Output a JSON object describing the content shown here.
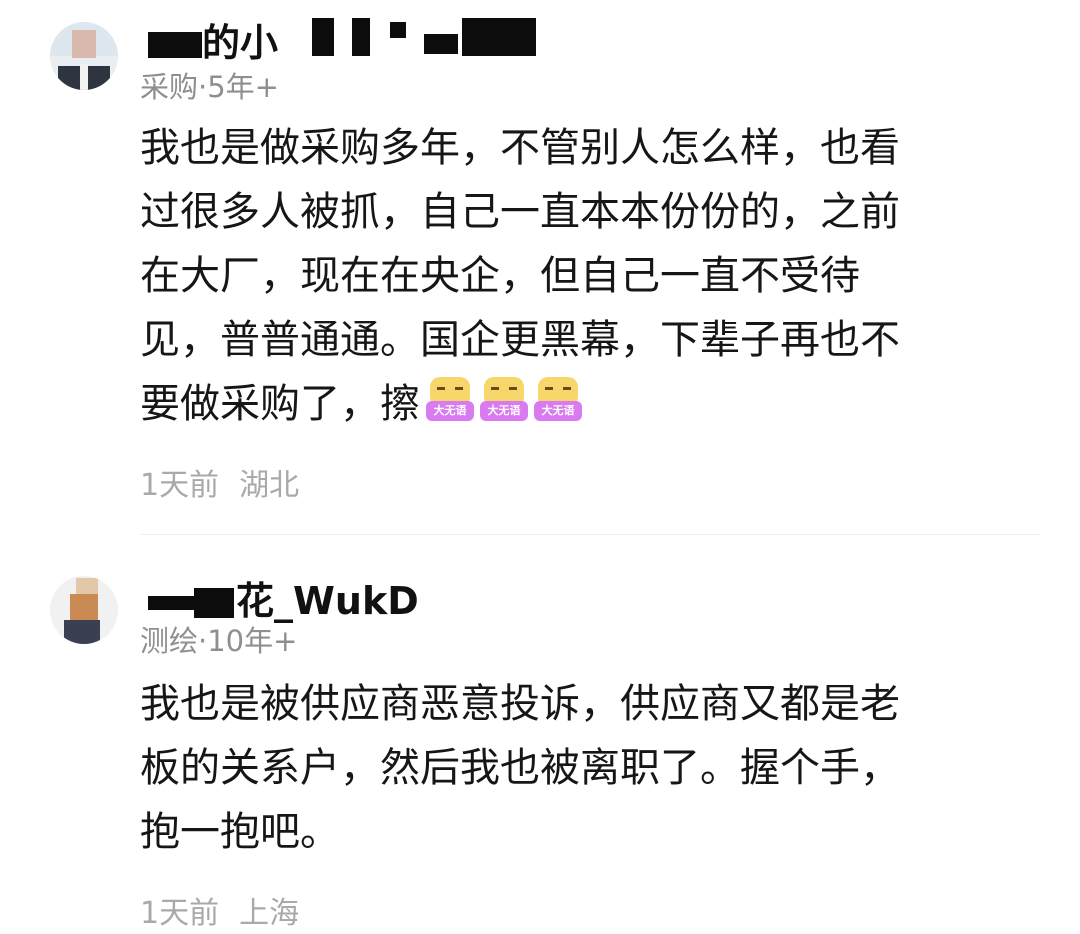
{
  "comments": [
    {
      "username": "的小",
      "meta": "采购·5年+",
      "body_lines": [
        "我也是做采购多年，不管别人怎么样，也看",
        "过很多人被抓，自己一直本本份份的，之前",
        "在大厂，现在在央企，但自己一直不受待",
        "见，普普通通。国企更黑幕，下辈子再也不"
      ],
      "body_last": "要做采购了，擦",
      "emoji": {
        "name": "speechless-emoji",
        "label": "大无语",
        "count": 3
      },
      "time": "1天前",
      "location": "湖北"
    },
    {
      "username": "花_WukD",
      "meta": "测绘·10年+",
      "body_lines": [
        "我也是被供应商恶意投诉，供应商又都是老",
        "板的关系户，然后我也被离职了。握个手，",
        "抱一抱吧。"
      ],
      "time": "1天前",
      "location": "上海"
    }
  ],
  "colors": {
    "text": "#161616",
    "meta": "#8f8f8f",
    "footer": "#a9a9a9",
    "mask": "#0c0c0c",
    "emoji_face": "#f7d66a",
    "emoji_label": "#d97af0"
  }
}
